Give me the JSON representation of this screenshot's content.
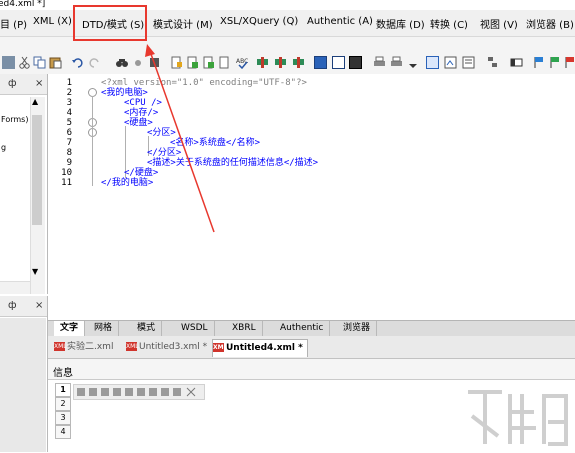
{
  "window": {
    "title": "ed4.xml *]"
  },
  "menu": {
    "items": [
      "目 (P)",
      "XML (X)",
      "DTD/模式 (S)",
      "模式设计 (M)",
      "XSL/XQuery (Q)",
      "Authentic (A)",
      "数据库 (D)",
      "转换 (C)",
      "视图 (V)",
      "浏览器 (B)"
    ]
  },
  "left_panel": {
    "top_text": [
      "Forms)",
      "g"
    ],
    "pin": "ф",
    "close": "×"
  },
  "editor": {
    "line_numbers": [
      "1",
      "2",
      "3",
      "4",
      "5",
      "6",
      "7",
      "8",
      "9",
      "10",
      "11"
    ],
    "lines": [
      "<?xml version=\"1.0\" encoding=\"UTF-8\"?>",
      "<我的电脑>",
      "<CPU />",
      "<内存/>",
      "<硬盘>",
      "<分区>",
      "<名称>系统盘</名称>",
      "</分区>",
      "<描述>关于系统盘的任何描述信息</描述>",
      "</硬盘>",
      "</我的电脑>"
    ]
  },
  "view_tabs": [
    "文字",
    "网格",
    "模式",
    "WSDL",
    "XBRL",
    "Authentic",
    "浏览器"
  ],
  "doc_tabs": [
    "实验二.xml",
    "Untitled3.xml *",
    "Untitled4.xml *"
  ],
  "info": {
    "label": "信息",
    "side_tabs": [
      "1",
      "2",
      "3",
      "4"
    ]
  },
  "colors": {
    "highlight": "#e8382e",
    "tag": "#0000ff",
    "pi": "#808080"
  }
}
